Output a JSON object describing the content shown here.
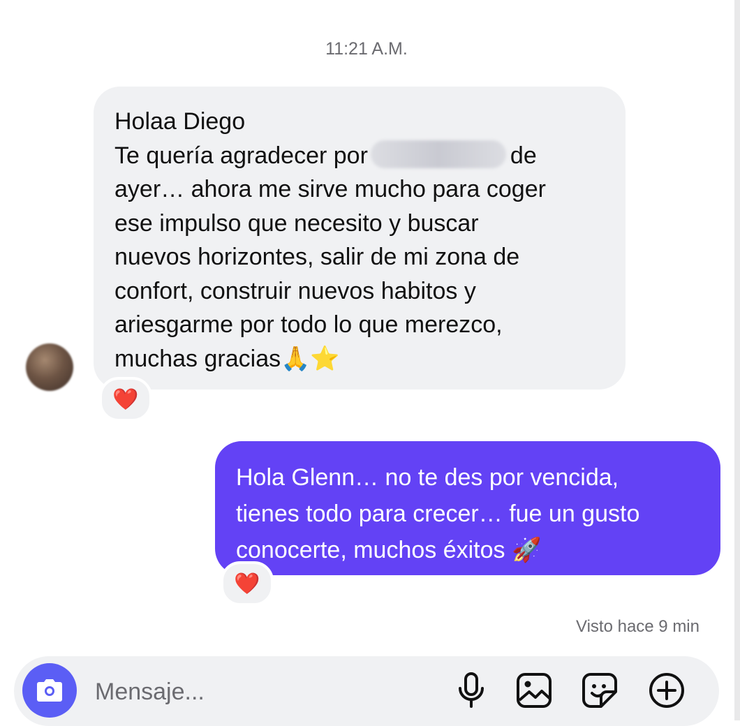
{
  "thread": {
    "timestamp": "11:21 A.M.",
    "incoming": {
      "lines": {
        "l1": "Holaa Diego",
        "l2a": "Te quería agradecer por",
        "l2b": "de",
        "l3": "ayer… ahora me sirve mucho para coger",
        "l4": "ese impulso que necesito y buscar",
        "l5": "nuevos horizontes, salir de mi zona de",
        "l6": "confort, construir nuevos habitos y",
        "l7": "ariesgarme por todo lo que merezco,",
        "l8": "muchas gracias🙏⭐"
      },
      "reaction": "❤️"
    },
    "outgoing": {
      "lines": {
        "l1": "Hola Glenn… no te des por vencida,",
        "l2": "tienes todo para crecer… fue un gusto",
        "l3": "conocerte, muchos éxitos 🚀"
      },
      "reaction": "❤️"
    },
    "seen_status": "Visto hace 9 min"
  },
  "composer": {
    "placeholder": "Mensaje...",
    "icons": [
      "camera-icon",
      "microphone-icon",
      "gallery-icon",
      "sticker-icon",
      "plus-circle-icon"
    ]
  },
  "colors": {
    "accent": "#6342f5",
    "camera_button": "#5b5ef5",
    "incoming_bubble": "#f0f1f3",
    "heart": "#e0182f"
  }
}
